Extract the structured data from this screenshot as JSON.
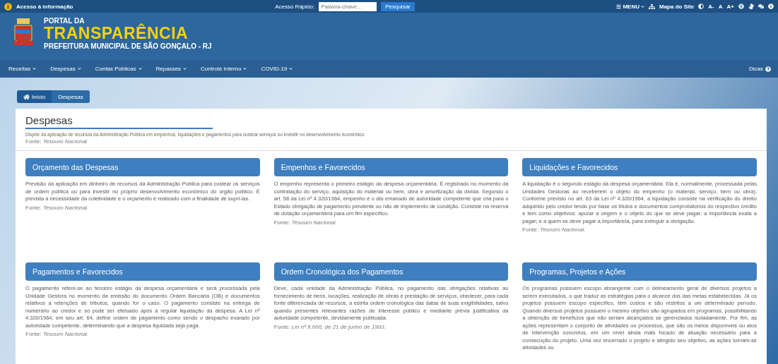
{
  "top_bar": {
    "access_info": "Acesso à informação",
    "quick_access_label": "Acesso Rápido:",
    "search": {
      "placeholder": "Palavra-chave..."
    },
    "search_button": "Pesquisar",
    "menu": "MENU",
    "sitemap": "Mapa do Site",
    "font_controls": [
      "A-",
      "A",
      "A+"
    ]
  },
  "header": {
    "portal_da": "PORTAL DA",
    "title": "TRANSPARÊNCIA",
    "subtitle": "PREFEITURA MUNICIPAL DE SÃO GONÇALO - RJ"
  },
  "nav": {
    "items": [
      "Receitas",
      "Despesas",
      "Contas Públicas",
      "Repasses",
      "Controle Interno",
      "COVID-19"
    ],
    "tips": "Dicas"
  },
  "breadcrumb": [
    {
      "label": "Início",
      "kind": "home"
    },
    {
      "label": "Despesas",
      "kind": "page"
    }
  ],
  "page": {
    "title": "Despesas",
    "description": "Dispõe da aplicação de recursos da Administração Pública em empenhos, liquidações e pagamentos para custear serviços ou investir no desenvolvimento econômico.",
    "source_label": "Fonte:",
    "source": "Tesouro Nacional"
  },
  "cards": [
    {
      "title": "Orçamento das Despesas",
      "text": "Previsão da aplicação em dinheiro de recursos da Administração Pública para custear os serviços de ordem pública ou para investir no próprio desenvolvimento econômico do órgão público. É prevista a necessidade da coletividade e o orçamento é realizado com a finalidade de supri-las.",
      "source_label": "Fonte:",
      "source": "Tesouro Nacional."
    },
    {
      "title": "Empenhos e Favorecidos",
      "text": "O empenho representa o primeiro estágio da despesa orçamentária. É registrado no momento da contratação do serviço, aquisição do material ou bem, obra e amortização da dívida. Segundo o art. 58 da Lei nº 4.320/1964, empenho é o ato emanado de autoridade competente que cria para o Estado obrigação de pagamento pendente ou não de implemento de condição. Consiste na reserva de dotação orçamentária para um fim específico.",
      "source_label": "Fonte:",
      "source": "Tesouro Nacional."
    },
    {
      "title": "Liquidações e Favorecidos",
      "text": "A liquidação é o segundo estágio da despesa orçamentária. Ela é, normalmente, processada pelas Unidades Gestoras ao receberem o objeto do empenho (o material, serviço, bem ou obra). Conforme previsto no art. 63 da Lei nº 4.320/1964, a liquidação consiste na verificação do direito adquirido pelo credor tendo por base os títulos e documentos comprobatórios do respectivo crédito e tem como objetivos: apurar a origem e o objeto do que se deve pagar; a importância exata a pagar; e a quem se deve pagar a importância, para extinguir a obrigação.",
      "source_label": "Fonte:",
      "source": "Tesouro Nacional."
    },
    {
      "title": "Pagamentos e Favorecidos",
      "text": "O pagamento refere-se ao terceiro estágio da despesa orçamentária e será processada pela Unidade Gestora no momento da emissão do documento Ordem Bancária (OB) e documentos relativos a retenções de tributos, quando for o caso. O pagamento consiste na entrega de numerário ao credor e só pode ser efetuado após a regular liquidação da despesa. A Lei nº 4.320/1964, em seu art. 64, define ordem de pagamento como sendo o despacho exarado por autoridade competente, determinando que a despesa liquidada seja paga.",
      "source_label": "Fonte:",
      "source": "Tesouro Nacional."
    },
    {
      "title": "Ordem Cronológica dos Pagamentos",
      "text": "Deve, cada unidade da Administração Pública, no pagamento das obrigações relativas ao fornecimento de bens, locações, realização de obras e prestação de serviços, obedecer, para cada fonte diferenciada de recursos, a estrita ordem cronológica das datas de suas exigibilidades, salvo quando presentes relevantes razões de interesse público e mediante prévia justificativa da autoridade competente, devidamente publicada.",
      "source_label": "Fonte:",
      "source": "Lei nº 8.666, de 21 de junho de 1993."
    },
    {
      "title": "Programas, Projetos e Ações",
      "text": "Os programas possuem escopo abrangente com o delineamento geral de diversos projetos a serem executados, o que traduz as estratégias para o alcance dos das metas estabelecidas. Já os projetos possuem escopo específico, têm custos e são restritos a um determinado período. Quando diversos projetos possuem o mesmo objetivo são agrupados em programas, possibilitando a obtenção de benefícios que não seriam alcançados se gerenciados isoladamente. Por fim, as ações representam o conjunto de atividades ou processos, que são os meios disponíveis ou atos de intervenção concretos, em um nível ainda mais focado de atuação necessário para a consecução do projeto. Uma vez encerrado o projeto e atingido seu objetivo, as ações tornam-se atividades ou"
    }
  ]
}
